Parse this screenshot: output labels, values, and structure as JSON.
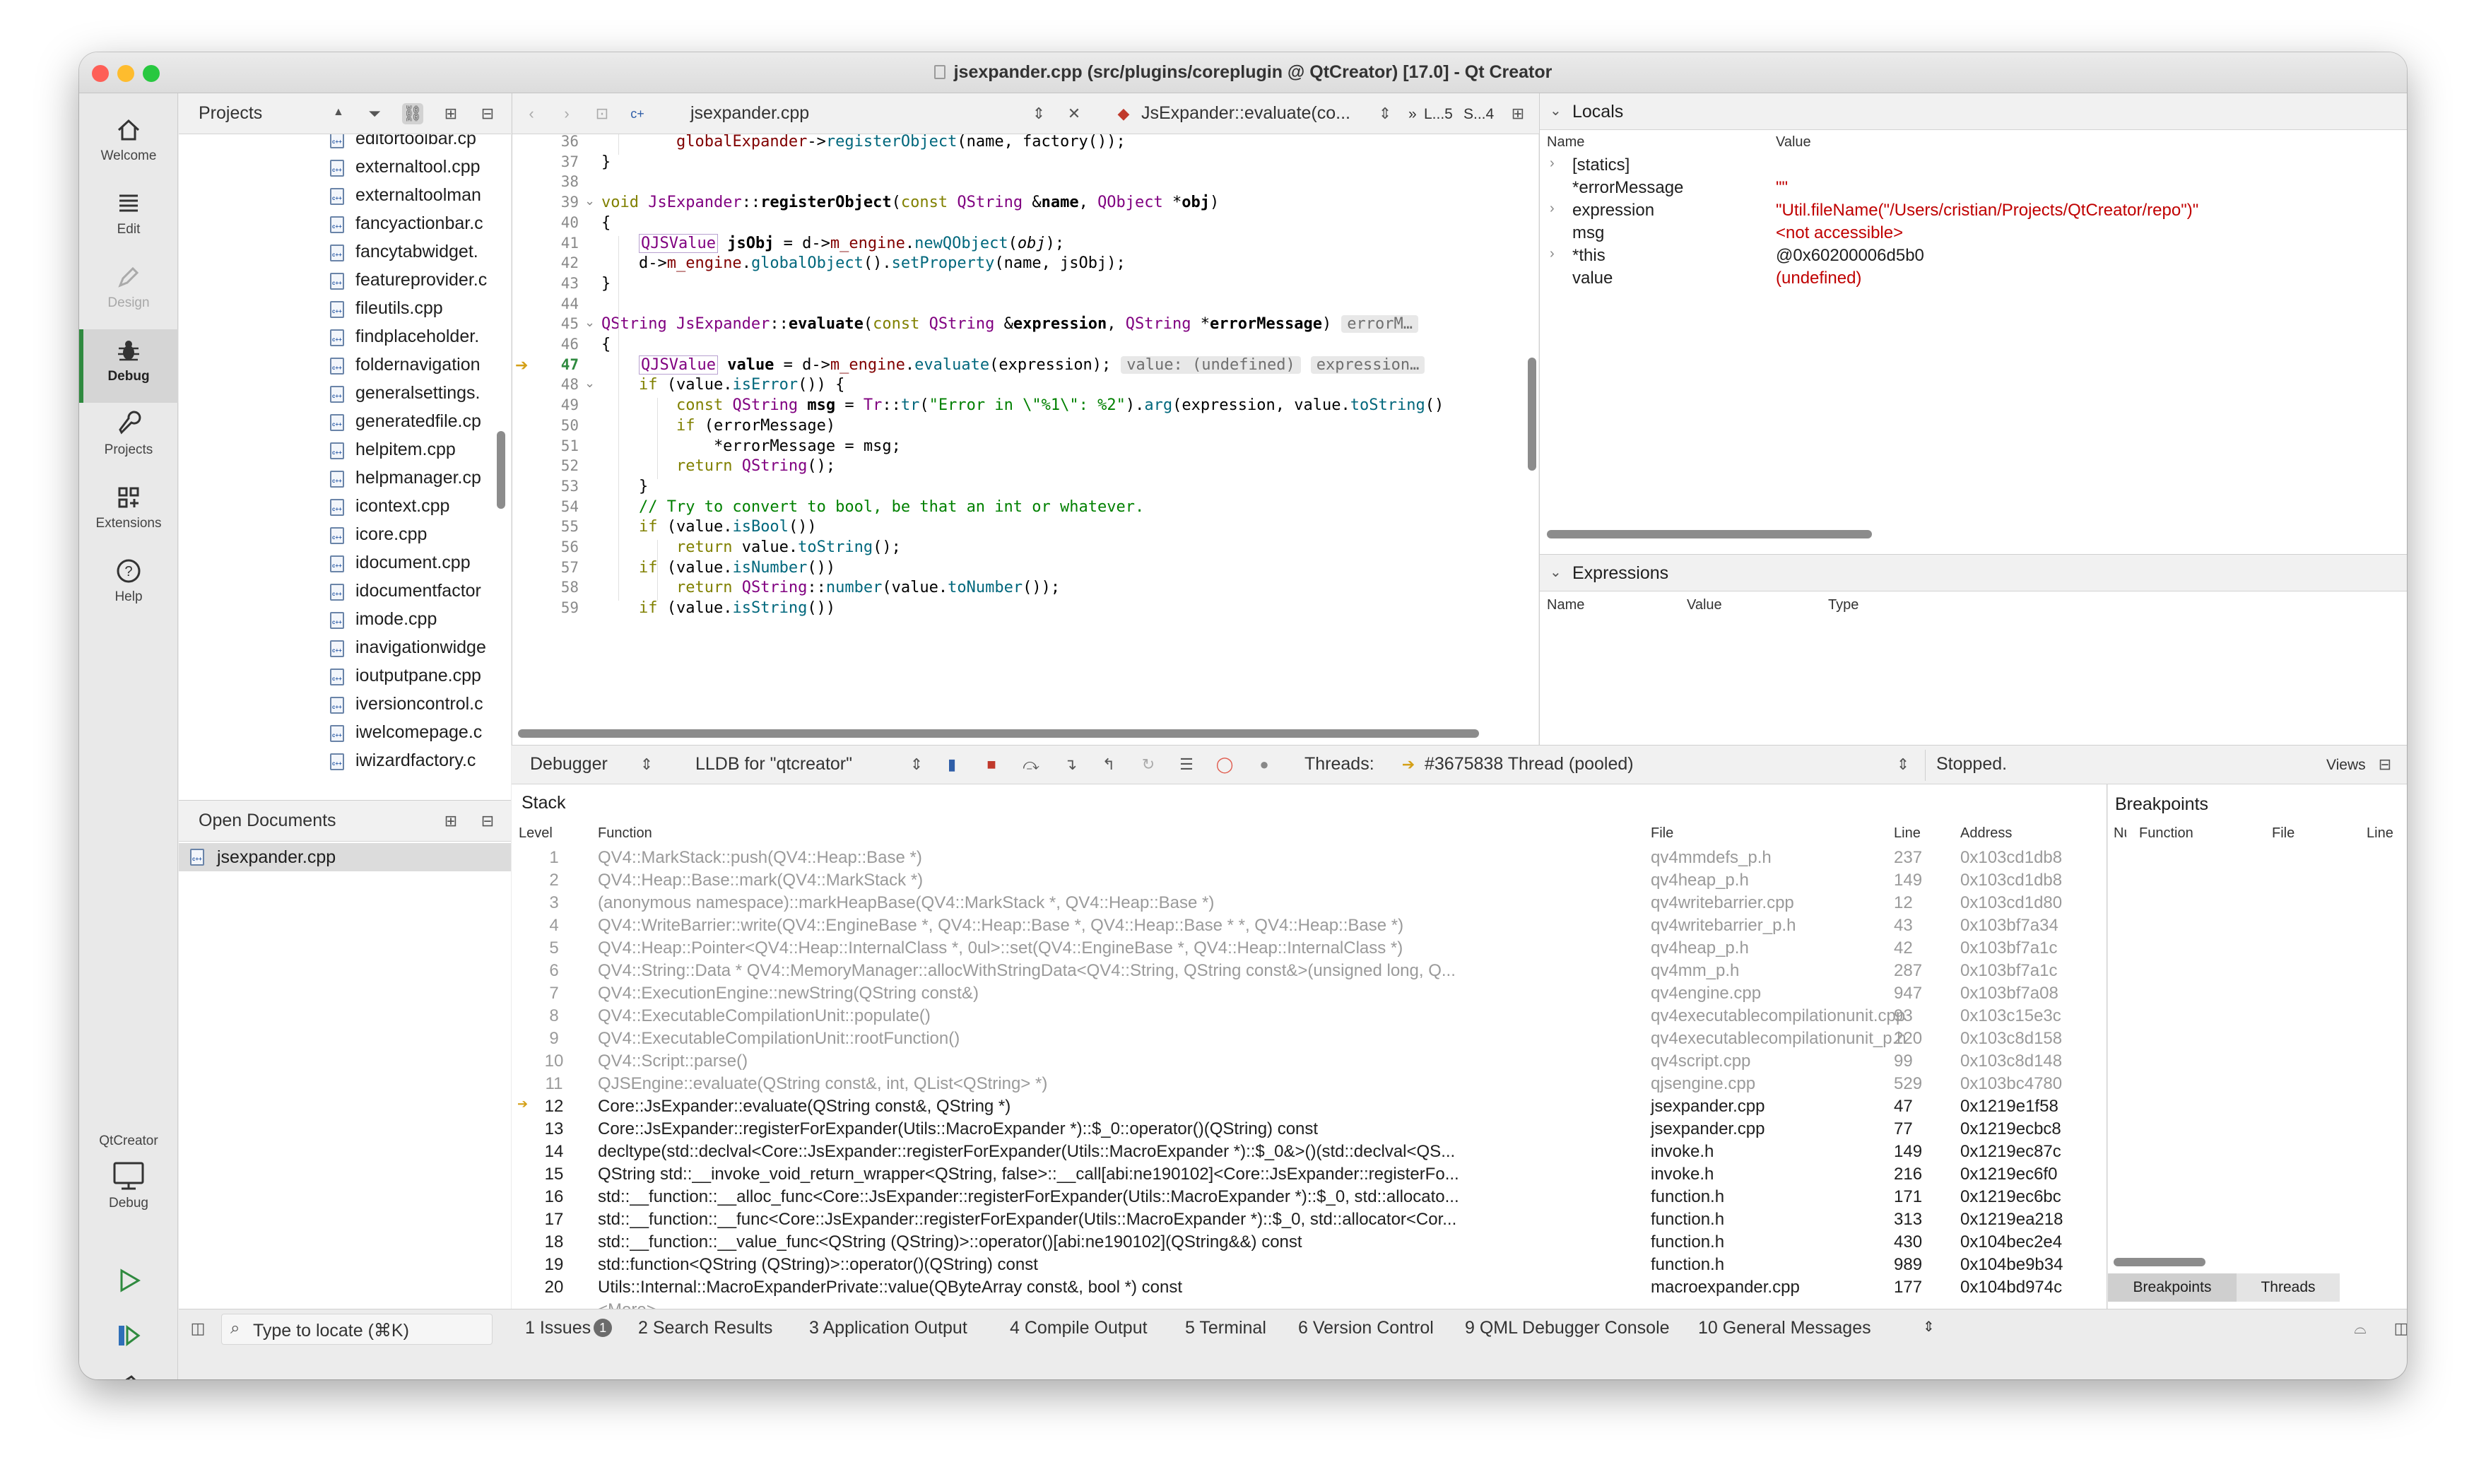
{
  "window": {
    "title": "jsexpander.cpp (src/plugins/coreplugin @ QtCreator) [17.0] - Qt Creator"
  },
  "modes": [
    {
      "label": "Welcome",
      "icon": "home-icon"
    },
    {
      "label": "Edit",
      "icon": "edit-lines-icon"
    },
    {
      "label": "Design",
      "icon": "pen-icon"
    },
    {
      "label": "Debug",
      "icon": "bug-icon"
    },
    {
      "label": "Projects",
      "icon": "wrench-icon"
    },
    {
      "label": "Extensions",
      "icon": "extensions-grid-icon"
    },
    {
      "label": "Help",
      "icon": "help-icon"
    }
  ],
  "kit": {
    "project": "QtCreator",
    "target": "Debug"
  },
  "projects": {
    "combo": "Projects",
    "files": [
      "editortoolbar.cp",
      "externaltool.cpp",
      "externaltoolman",
      "fancyactionbar.c",
      "fancytabwidget.",
      "featureprovider.c",
      "fileutils.cpp",
      "findplaceholder.",
      "foldernavigation",
      "generalsettings.",
      "generatedfile.cp",
      "helpitem.cpp",
      "helpmanager.cp",
      "icontext.cpp",
      "icore.cpp",
      "idocument.cpp",
      "idocumentfactor",
      "imode.cpp",
      "inavigationwidge",
      "ioutputpane.cpp",
      "iversioncontrol.c",
      "iwelcomepage.c",
      "iwizardfactory.c"
    ]
  },
  "open_documents": {
    "combo": "Open Documents",
    "items": [
      "jsexpander.cpp"
    ]
  },
  "editor": {
    "file_combo": "jsexpander.cpp",
    "symbol_combo": "JsExpander::evaluate(co...",
    "position": "L...5",
    "column": "S...4",
    "more": "»",
    "current_line": "47",
    "lines": [
      {
        "n": "36",
        "html": "        <span class=\"mb\">globalExpander</span>-&gt;<span class=\"fn\">registerObject</span>(name, factory());"
      },
      {
        "n": "37",
        "html": "}"
      },
      {
        "n": "38",
        "html": ""
      },
      {
        "n": "39",
        "html": "<span class=\"kw\">void</span> <span class=\"ty\">JsExpander</span>::<b>registerObject</b>(<span class=\"kw\">const</span> <span class=\"ty\">QString</span> &amp;<b>name</b>, <span class=\"ty\">QObject</span> *<b>obj</b>)"
      },
      {
        "n": "40",
        "html": "{"
      },
      {
        "n": "41",
        "html": "    <span class=\"ty qjs\">QJSValue</span> <b>jsObj</b> = d-&gt;<span class=\"mb\">m_engine</span>.<span class=\"fn\">newQObject</span>(<i>obj</i>);"
      },
      {
        "n": "42",
        "html": "    d-&gt;<span class=\"mb\">m_engine</span>.<span class=\"fn\">globalObject</span>().<span class=\"fn\">setProperty</span>(name, jsObj);"
      },
      {
        "n": "43",
        "html": "}"
      },
      {
        "n": "44",
        "html": ""
      },
      {
        "n": "45",
        "html": "<span class=\"ty\">QString</span> <span class=\"ty\">JsExpander</span>::<b>evaluate</b>(<span class=\"kw\">const</span> <span class=\"ty\">QString</span> &amp;<b>expression</b>, <span class=\"ty\">QString</span> *<b>errorMessage</b>)<span class=\"hint\">errorM…</span>"
      },
      {
        "n": "46",
        "html": "{"
      },
      {
        "n": "47",
        "html": "    <span class=\"ty qjs\">QJSValue</span> <b>value</b> = d-&gt;<span class=\"mb\">m_engine</span>.<span class=\"fn\">evaluate</span>(expression);<span class=\"hint\">value: (undefined)</span><span class=\"hint\">expression…</span>"
      },
      {
        "n": "48",
        "html": "    <span class=\"kw\">if</span> (value.<span class=\"fn\">isError</span>()) {"
      },
      {
        "n": "49",
        "html": "        <span class=\"kw\">const</span> <span class=\"ty\">QString</span> <b>msg</b> = <span class=\"ty\">Tr</span>::<span class=\"fn\">tr</span>(<span class=\"st\">\"Error in \\\"%1\\\": %2\"</span>).<span class=\"fn\">arg</span>(expression, value.<span class=\"fn\">toString</span>()"
      },
      {
        "n": "50",
        "html": "        <span class=\"kw\">if</span> (errorMessage)"
      },
      {
        "n": "51",
        "html": "            *errorMessage = msg;"
      },
      {
        "n": "52",
        "html": "        <span class=\"kw\">return</span> <span class=\"ty\">QString</span>();"
      },
      {
        "n": "53",
        "html": "    }"
      },
      {
        "n": "54",
        "html": "    <span class=\"cm\">// Try to convert to bool, be that an int or whatever.</span>"
      },
      {
        "n": "55",
        "html": "    <span class=\"kw\">if</span> (value.<span class=\"fn\">isBool</span>())"
      },
      {
        "n": "56",
        "html": "        <span class=\"kw\">return</span> value.<span class=\"fn\">toString</span>();"
      },
      {
        "n": "57",
        "html": "    <span class=\"kw\">if</span> (value.<span class=\"fn\">isNumber</span>())"
      },
      {
        "n": "58",
        "html": "        <span class=\"kw\">return</span> <span class=\"ty\">QString</span>::<span class=\"fn\">number</span>(value.<span class=\"fn\">toNumber</span>());"
      },
      {
        "n": "59",
        "html": "    <span class=\"kw\">if</span> (value.<span class=\"fn\">isString</span>())"
      }
    ]
  },
  "locals": {
    "title": "Locals",
    "headers": [
      "Name",
      "Value"
    ],
    "rows": [
      {
        "name": "[statics]",
        "value": "",
        "expand": true,
        "red": false
      },
      {
        "name": "*errorMessage",
        "value": "\"\"",
        "expand": false,
        "red": true
      },
      {
        "name": "expression",
        "value": "\"Util.fileName(\"/Users/cristian/Projects/QtCreator/repo\")\"",
        "expand": true,
        "red": true
      },
      {
        "name": "msg",
        "value": "<not accessible>",
        "expand": false,
        "red": true
      },
      {
        "name": "*this",
        "value": "@0x60200006d5b0",
        "expand": true,
        "red": false
      },
      {
        "name": "value",
        "value": "(undefined)",
        "expand": false,
        "red": true
      }
    ]
  },
  "expressions": {
    "title": "Expressions",
    "headers": [
      "Name",
      "Value",
      "Type"
    ]
  },
  "debugger_bar": {
    "mode": "Debugger",
    "engine": "LLDB for \"qtcreator\"",
    "threads_label": "Threads:",
    "thread": "#3675838 Thread (pooled)",
    "status": "Stopped.",
    "views": "Views"
  },
  "stack": {
    "title": "Stack",
    "headers": [
      "Level",
      "Function",
      "File",
      "Line",
      "Address"
    ],
    "frames": [
      {
        "level": "1",
        "fn": "QV4::MarkStack::push(QV4::Heap::Base *)",
        "file": "qv4mmdefs_p.h",
        "line": "237",
        "addr": "0x103cd1db8",
        "grey": true
      },
      {
        "level": "2",
        "fn": "QV4::Heap::Base::mark(QV4::MarkStack *)",
        "file": "qv4heap_p.h",
        "line": "149",
        "addr": "0x103cd1db8",
        "grey": true
      },
      {
        "level": "3",
        "fn": "(anonymous namespace)::markHeapBase(QV4::MarkStack *, QV4::Heap::Base *)",
        "file": "qv4writebarrier.cpp",
        "line": "12",
        "addr": "0x103cd1d80",
        "grey": true
      },
      {
        "level": "4",
        "fn": "QV4::WriteBarrier::write(QV4::EngineBase *, QV4::Heap::Base *, QV4::Heap::Base * *, QV4::Heap::Base *)",
        "file": "qv4writebarrier_p.h",
        "line": "43",
        "addr": "0x103bf7a34",
        "grey": true
      },
      {
        "level": "5",
        "fn": "QV4::Heap::Pointer<QV4::Heap::InternalClass *, 0ul>::set(QV4::EngineBase *, QV4::Heap::InternalClass *)",
        "file": "qv4heap_p.h",
        "line": "42",
        "addr": "0x103bf7a1c",
        "grey": true
      },
      {
        "level": "6",
        "fn": "QV4::String::Data * QV4::MemoryManager::allocWithStringData<QV4::String, QString const&>(unsigned long, Q...",
        "file": "qv4mm_p.h",
        "line": "287",
        "addr": "0x103bf7a1c",
        "grey": true
      },
      {
        "level": "7",
        "fn": "QV4::ExecutionEngine::newString(QString const&)",
        "file": "qv4engine.cpp",
        "line": "947",
        "addr": "0x103bf7a08",
        "grey": true
      },
      {
        "level": "8",
        "fn": "QV4::ExecutableCompilationUnit::populate()",
        "file": "qv4executablecompilationunit.cpp",
        "line": "93",
        "addr": "0x103c15e3c",
        "grey": true
      },
      {
        "level": "9",
        "fn": "QV4::ExecutableCompilationUnit::rootFunction()",
        "file": "qv4executablecompilationunit_p.h",
        "line": "220",
        "addr": "0x103c8d158",
        "grey": true
      },
      {
        "level": "10",
        "fn": "QV4::Script::parse()",
        "file": "qv4script.cpp",
        "line": "99",
        "addr": "0x103c8d148",
        "grey": true
      },
      {
        "level": "11",
        "fn": "QJSEngine::evaluate(QString const&, int, QList<QString> *)",
        "file": "qjsengine.cpp",
        "line": "529",
        "addr": "0x103bc4780",
        "grey": true
      },
      {
        "level": "12",
        "fn": "Core::JsExpander::evaluate(QString const&, QString *)",
        "file": "jsexpander.cpp",
        "line": "47",
        "addr": "0x1219e1f58",
        "grey": false,
        "current": true
      },
      {
        "level": "13",
        "fn": "Core::JsExpander::registerForExpander(Utils::MacroExpander *)::$_0::operator()(QString) const",
        "file": "jsexpander.cpp",
        "line": "77",
        "addr": "0x1219ecbc8",
        "grey": false
      },
      {
        "level": "14",
        "fn": "decltype(std::declval<Core::JsExpander::registerForExpander(Utils::MacroExpander *)::$_0&>()(std::declval<QS...",
        "file": "invoke.h",
        "line": "149",
        "addr": "0x1219ec87c",
        "grey": false
      },
      {
        "level": "15",
        "fn": "QString std::__invoke_void_return_wrapper<QString, false>::__call[abi:ne190102]<Core::JsExpander::registerFo...",
        "file": "invoke.h",
        "line": "216",
        "addr": "0x1219ec6f0",
        "grey": false
      },
      {
        "level": "16",
        "fn": "std::__function::__alloc_func<Core::JsExpander::registerForExpander(Utils::MacroExpander *)::$_0, std::allocato...",
        "file": "function.h",
        "line": "171",
        "addr": "0x1219ec6bc",
        "grey": false
      },
      {
        "level": "17",
        "fn": "std::__function::__func<Core::JsExpander::registerForExpander(Utils::MacroExpander *)::$_0, std::allocator<Cor...",
        "file": "function.h",
        "line": "313",
        "addr": "0x1219ea218",
        "grey": false
      },
      {
        "level": "18",
        "fn": "std::__function::__value_func<QString (QString)>::operator()[abi:ne190102](QString&&) const",
        "file": "function.h",
        "line": "430",
        "addr": "0x104bec2e4",
        "grey": false
      },
      {
        "level": "19",
        "fn": "std::function<QString (QString)>::operator()(QString) const",
        "file": "function.h",
        "line": "989",
        "addr": "0x104be9b34",
        "grey": false
      },
      {
        "level": "20",
        "fn": "Utils::Internal::MacroExpanderPrivate::value(QByteArray const&, bool *) const",
        "file": "macroexpander.cpp",
        "line": "177",
        "addr": "0x104bd974c",
        "grey": false
      },
      {
        "level": "...",
        "fn": "<More>",
        "file": "",
        "line": "",
        "addr": "",
        "grey": true
      }
    ]
  },
  "breakpoints": {
    "title": "Breakpoints",
    "headers": [
      "Nu",
      "Function",
      "File",
      "Line"
    ],
    "tabs": [
      "Breakpoints",
      "Threads"
    ]
  },
  "statusbar": {
    "locator_placeholder": "Type to locate (⌘K)",
    "tabs": [
      {
        "n": "1",
        "label": "Issues",
        "badge": "1"
      },
      {
        "n": "2",
        "label": "Search Results"
      },
      {
        "n": "3",
        "label": "Application Output"
      },
      {
        "n": "4",
        "label": "Compile Output"
      },
      {
        "n": "5",
        "label": "Terminal"
      },
      {
        "n": "6",
        "label": "Version Control"
      },
      {
        "n": "9",
        "label": "QML Debugger Console"
      },
      {
        "n": "10",
        "label": "General Messages"
      }
    ]
  },
  "colors": {
    "close": "#fe5f57",
    "minimize": "#febc2e",
    "maximize": "#28c840",
    "accent": "#2f8a3f",
    "error": "#c00000"
  }
}
